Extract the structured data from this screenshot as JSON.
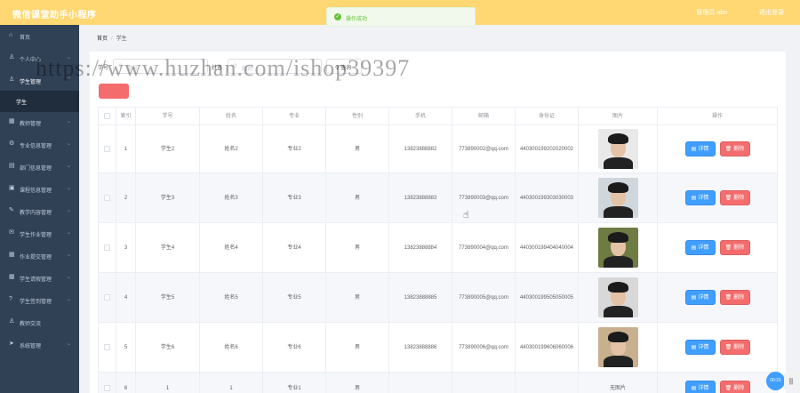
{
  "header": {
    "app_title": "微信课堂助手小程序",
    "user_text": "管理员 abo",
    "logout_label": "退出登录"
  },
  "toast": {
    "text": "操作成功"
  },
  "sidebar": {
    "items": [
      {
        "label": "首页",
        "icon": "home-icon"
      },
      {
        "label": "个人中心",
        "icon": "user-icon"
      },
      {
        "label": "学生管理",
        "icon": "user-icon"
      },
      {
        "label": "学生",
        "icon": ""
      },
      {
        "label": "教师管理",
        "icon": "grid-icon"
      },
      {
        "label": "专业信息管理",
        "icon": "settings-icon"
      },
      {
        "label": "部门信息管理",
        "icon": "folder-icon"
      },
      {
        "label": "课程信息管理",
        "icon": "document-icon"
      },
      {
        "label": "教学内容管理",
        "icon": "book-icon"
      },
      {
        "label": "学生作业管理",
        "icon": "mail-icon"
      },
      {
        "label": "作业提交管理",
        "icon": "apps-icon"
      },
      {
        "label": "学生请假管理",
        "icon": "apps-icon"
      },
      {
        "label": "学生签到管理",
        "icon": "help-icon"
      },
      {
        "label": "教师交流",
        "icon": "user-icon"
      },
      {
        "label": "系统管理",
        "icon": "send-icon"
      }
    ]
  },
  "breadcrumb": {
    "home": "首页",
    "current": "学生"
  },
  "search": {
    "field1_label": "学号",
    "field1_placeholder": "学号",
    "field2_label": "姓名",
    "field2_placeholder": "姓名",
    "query_label": "查询"
  },
  "watermark": "https://www.huzhan.com/ishop39397",
  "table": {
    "headers": [
      "索引",
      "学号",
      "姓名",
      "专业",
      "性别",
      "手机",
      "邮箱",
      "身份证",
      "图片",
      "操作"
    ],
    "detail_label": "详情",
    "delete_label": "删除",
    "rows": [
      {
        "index": "1",
        "student_id": "学生2",
        "name": "姓名2",
        "major": "专业2",
        "gender": "男",
        "phone": "13823888882",
        "email": "773890002@qq.com",
        "id_card": "440300199202020002",
        "photo": ""
      },
      {
        "index": "2",
        "student_id": "学生3",
        "name": "姓名3",
        "major": "专业3",
        "gender": "男",
        "phone": "13823888883",
        "email": "773890003@qq.com",
        "id_card": "440300199303030003",
        "photo": ""
      },
      {
        "index": "3",
        "student_id": "学生4",
        "name": "姓名4",
        "major": "专业4",
        "gender": "男",
        "phone": "13823888884",
        "email": "773890004@qq.com",
        "id_card": "440300199404040004",
        "photo": ""
      },
      {
        "index": "4",
        "student_id": "学生5",
        "name": "姓名5",
        "major": "专业5",
        "gender": "男",
        "phone": "13823888885",
        "email": "773890005@qq.com",
        "id_card": "440300199505050005",
        "photo": ""
      },
      {
        "index": "5",
        "student_id": "学生6",
        "name": "姓名6",
        "major": "专业6",
        "gender": "男",
        "phone": "13823888886",
        "email": "773890006@qq.com",
        "id_card": "440300199606060006",
        "photo": ""
      },
      {
        "index": "6",
        "student_id": "1",
        "name": "1",
        "major": "专业1",
        "gender": "男",
        "phone": "",
        "email": "",
        "id_card": "",
        "photo": "无图片"
      }
    ]
  },
  "floating": {
    "timer": "00:31",
    "pause": "||"
  },
  "colors": {
    "header": "#ffd873",
    "sidebar": "#304156",
    "primary": "#409eff",
    "danger": "#f56c6c",
    "success": "#67c23a"
  }
}
